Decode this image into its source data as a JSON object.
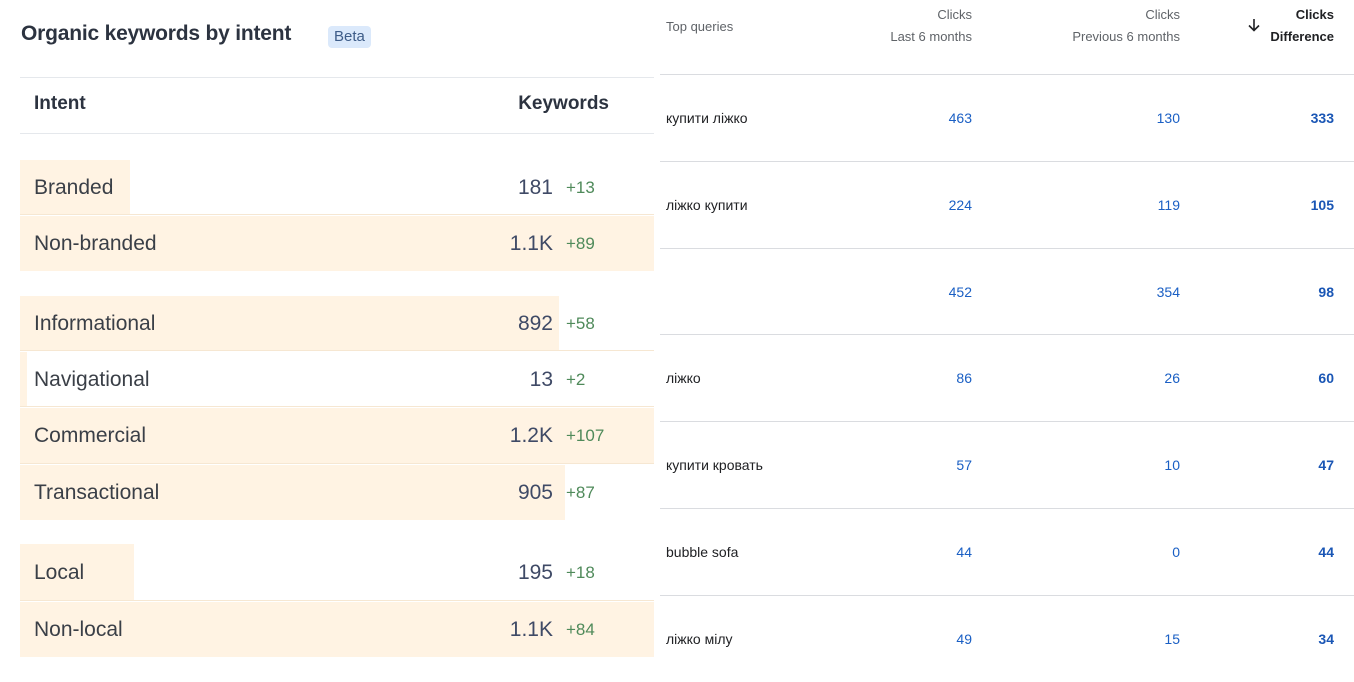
{
  "intent_panel": {
    "title": "Organic keywords by intent",
    "badge": "Beta",
    "header": {
      "intent": "Intent",
      "keywords": "Keywords"
    },
    "rows": [
      {
        "label": "Branded",
        "value": "181",
        "delta": "+13",
        "fill": 0.17
      },
      {
        "label": "Non-branded",
        "value": "1.1K",
        "delta": "+89",
        "fill": 1.0
      },
      {
        "label": "Informational",
        "value": "892",
        "delta": "+58",
        "fill": 0.85
      },
      {
        "label": "Navigational",
        "value": "13",
        "delta": "+2",
        "fill": 0.01
      },
      {
        "label": "Commercial",
        "value": "1.2K",
        "delta": "+107",
        "fill": 1.0
      },
      {
        "label": "Transactional",
        "value": "905",
        "delta": "+87",
        "fill": 0.86
      },
      {
        "label": "Local",
        "value": "195",
        "delta": "+18",
        "fill": 0.18
      },
      {
        "label": "Non-local",
        "value": "1.1K",
        "delta": "+84",
        "fill": 1.0
      }
    ]
  },
  "queries_panel": {
    "header": {
      "query": "Top queries",
      "col1": {
        "line1": "Clicks",
        "line2": "Last 6 months"
      },
      "col2": {
        "line1": "Clicks",
        "line2": "Previous 6 months"
      },
      "col3": {
        "line1": "Clicks",
        "line2": "Difference"
      },
      "sort_icon": "arrow-down-icon"
    },
    "rows": [
      {
        "query": "купити ліжко",
        "last": "463",
        "previous": "130",
        "diff": "333"
      },
      {
        "query": "ліжко купити",
        "last": "224",
        "previous": "119",
        "diff": "105"
      },
      {
        "query": "",
        "last": "452",
        "previous": "354",
        "diff": "98"
      },
      {
        "query": "ліжко",
        "last": "86",
        "previous": "26",
        "diff": "60"
      },
      {
        "query": "купити кровать",
        "last": "57",
        "previous": "10",
        "diff": "47"
      },
      {
        "query": "bubble sofa",
        "last": "44",
        "previous": "0",
        "diff": "44"
      },
      {
        "query": "ліжко мілу",
        "last": "49",
        "previous": "15",
        "diff": "34"
      }
    ]
  }
}
